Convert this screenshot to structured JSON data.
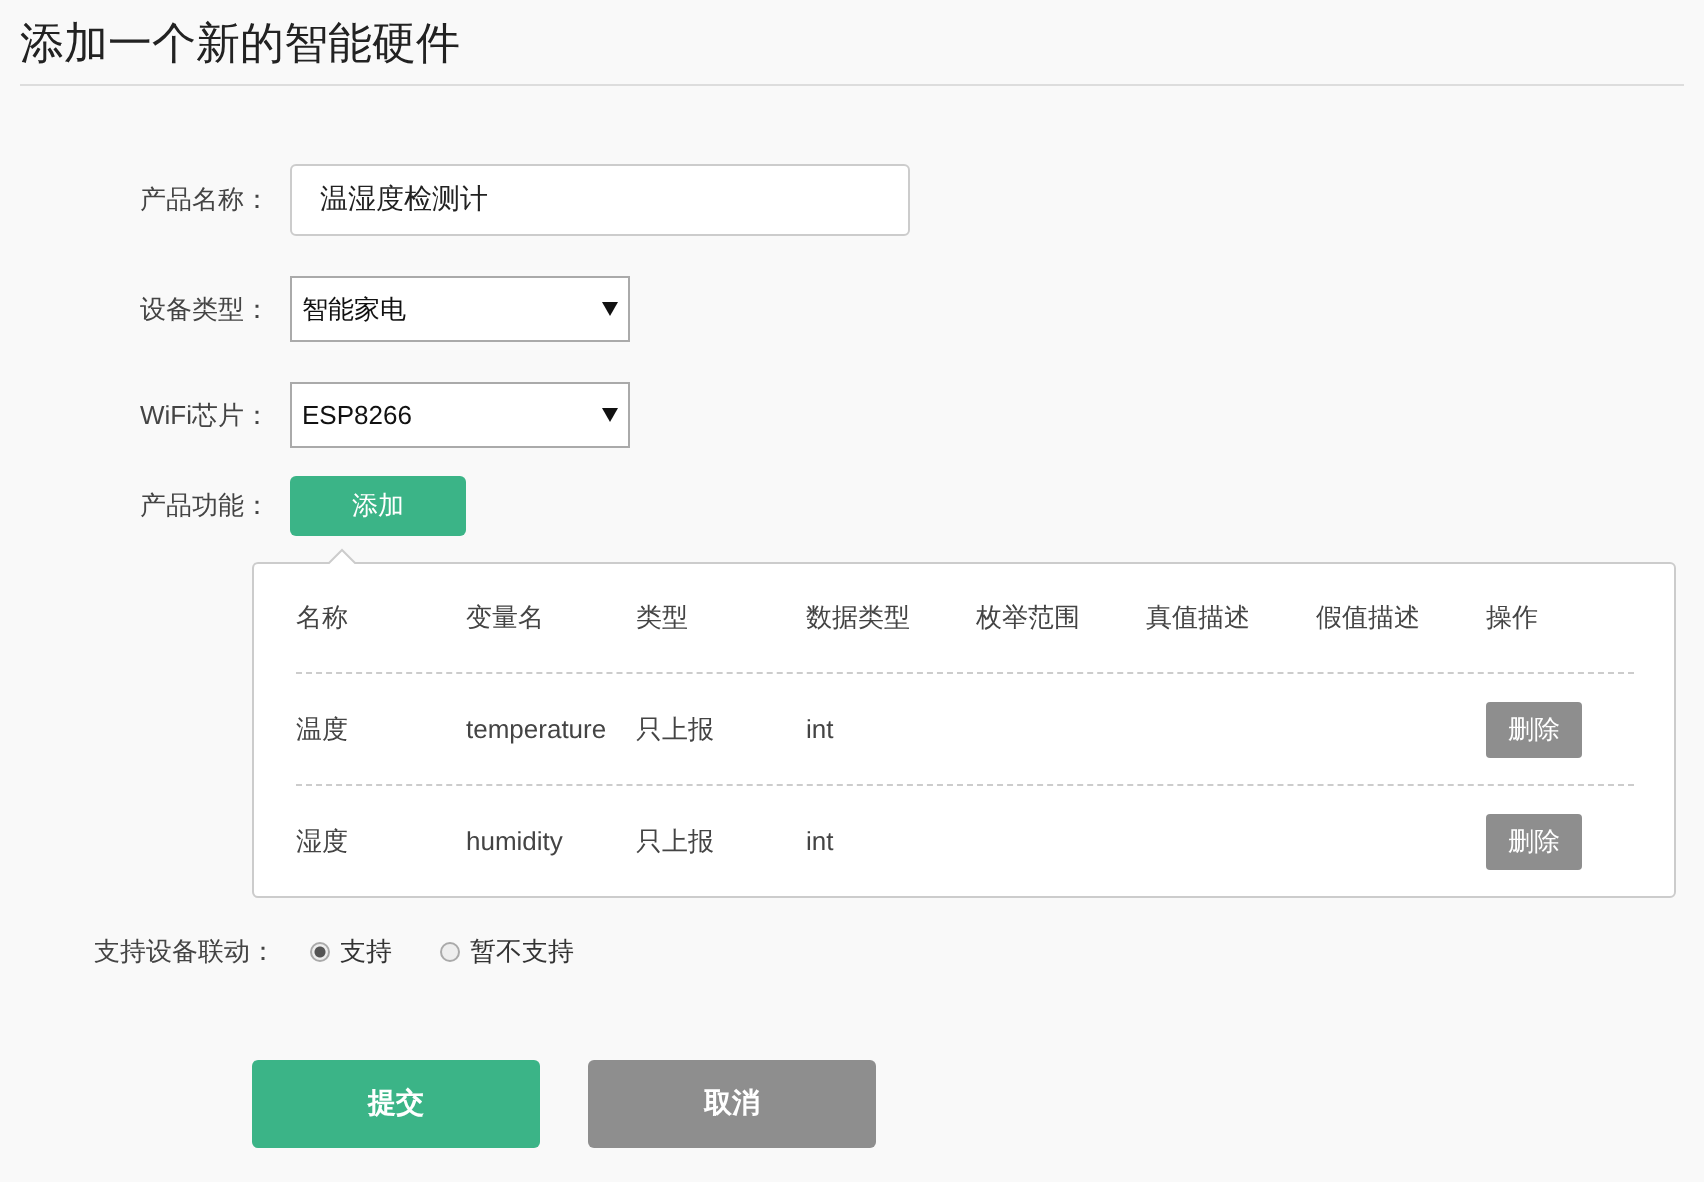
{
  "title": "添加一个新的智能硬件",
  "fields": [
    {
      "kind": "text",
      "label": "产品名称：",
      "value": "温湿度检测计"
    },
    {
      "kind": "select",
      "label": "设备类型：",
      "value": "智能家电"
    },
    {
      "kind": "select",
      "label": "WiFi芯片：",
      "value": "ESP8266"
    },
    {
      "kind": "button",
      "label": "产品功能：",
      "value": "添加"
    }
  ],
  "table": {
    "columns": [
      "名称",
      "变量名",
      "类型",
      "数据类型",
      "枚举范围",
      "真值描述",
      "假值描述",
      "操作"
    ],
    "rows": [
      {
        "name": "温度",
        "variable": "temperature",
        "type": "只上报",
        "data_type": "int",
        "action": "删除"
      },
      {
        "name": "湿度",
        "variable": "humidity",
        "type": "只上报",
        "data_type": "int",
        "action": "删除"
      }
    ]
  },
  "linkage": {
    "label": "支持设备联动：",
    "options": [
      {
        "label": "支持",
        "selected": true
      },
      {
        "label": "暂不支持",
        "selected": false
      }
    ]
  },
  "buttons": [
    {
      "kind": "primary",
      "label": "提交"
    },
    {
      "kind": "secondary",
      "label": "取消"
    }
  ]
}
